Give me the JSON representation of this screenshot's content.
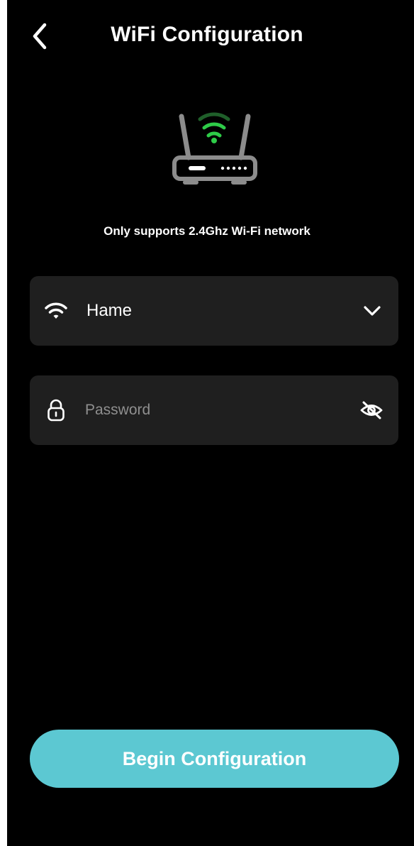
{
  "header": {
    "title": "WiFi Configuration",
    "back_icon": "chevron-left-icon"
  },
  "illustration": {
    "icon": "wifi-router-icon",
    "signal_color": "#2ecc48",
    "body_color": "#8c8c8c"
  },
  "notice": {
    "text": "Only supports 2.4Ghz Wi-Fi network"
  },
  "network_field": {
    "icon": "wifi-icon",
    "value": "Hame",
    "dropdown_icon": "chevron-down-icon"
  },
  "password_field": {
    "icon": "lock-icon",
    "placeholder": "Password",
    "value": "",
    "visibility_icon": "eye-slash-icon"
  },
  "actions": {
    "begin_label": "Begin Configuration"
  },
  "colors": {
    "background": "#000000",
    "field_background": "#1f1f1f",
    "accent": "#5cc8d2",
    "placeholder": "#8f8f8f"
  }
}
